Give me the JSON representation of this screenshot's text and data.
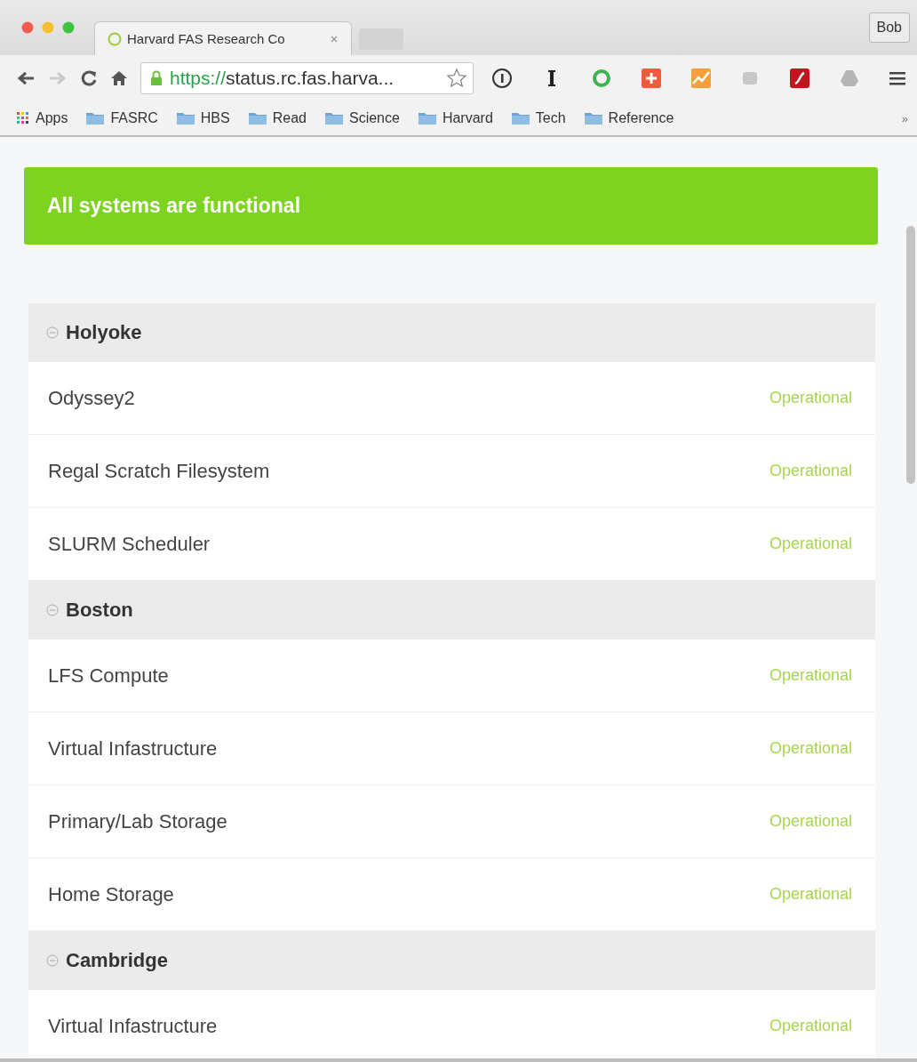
{
  "window": {
    "tab_title": "Harvard FAS Research Co",
    "profile": "Bob"
  },
  "toolbar": {
    "url_scheme": "https://",
    "url_rest": "status.rc.fas.harva...",
    "extensions": [
      {
        "kind": "info"
      },
      {
        "kind": "text-i"
      },
      {
        "kind": "ring"
      },
      {
        "kind": "plus"
      },
      {
        "kind": "chart"
      },
      {
        "kind": "gray"
      },
      {
        "kind": "flash"
      },
      {
        "kind": "drive"
      }
    ]
  },
  "bookmarks": {
    "apps": "Apps",
    "folders": [
      "FASRC",
      "HBS",
      "Read",
      "Science",
      "Harvard",
      "Tech",
      "Reference"
    ],
    "more": "»"
  },
  "banner": "All systems are functional",
  "groups": [
    {
      "name": "Holyoke",
      "expanded": true,
      "items": [
        {
          "name": "Odyssey2",
          "status": "Operational"
        },
        {
          "name": "Regal Scratch Filesystem",
          "status": "Operational"
        },
        {
          "name": "SLURM Scheduler",
          "status": "Operational"
        }
      ]
    },
    {
      "name": "Boston",
      "expanded": true,
      "items": [
        {
          "name": "LFS Compute",
          "status": "Operational"
        },
        {
          "name": "Virtual Infastructure",
          "status": "Operational"
        },
        {
          "name": "Primary/Lab Storage",
          "status": "Operational"
        },
        {
          "name": "Home Storage",
          "status": "Operational"
        }
      ]
    },
    {
      "name": "Cambridge",
      "expanded": true,
      "items": [
        {
          "name": "Virtual Infastructure",
          "status": "Operational"
        }
      ]
    }
  ]
}
